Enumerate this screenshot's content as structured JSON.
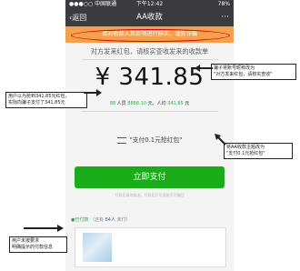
{
  "status_bar": {
    "carrier": "●●●○○ 中国联通",
    "time": "下午12:42",
    "battery": "78%"
  },
  "nav": {
    "back_label": "返回",
    "title": "AA收款",
    "more": "···"
  },
  "warning": "请对收款人及款项进行核实，谨防诈骗",
  "description": "对方发来红包，请核实查收发来的收款单",
  "amount": "¥ 341.85",
  "breakdown": {
    "count": "88",
    "people_label": "人员",
    "total": "8888.10",
    "total_label": "元，人均",
    "per_person": "341.85",
    "unit": "元"
  },
  "reason": "\"支付0.1元抢红包\"",
  "pay_button": "立即支付",
  "notice": "付款后请勿取消，付款后只可退款不可撤回",
  "record": {
    "paid_label": "●已付款",
    "mid": "（还有",
    "count": "84人",
    "end": "未付）"
  },
  "annotations": {
    "right_top": "骗子将账号昵称改为\n\"对方发来红包，请核实查收\"",
    "left": "用户以为抢到341.85元红包，\n实际向骗子支付了341.85元",
    "right_mid": "将AA收款主题改为\n\"支付0.1元抢红包\"",
    "left_bottom": "用户未按要求\n明确提示的付款信息"
  },
  "colors": {
    "nav_bg": "#3b3b3f",
    "warning_bg": "#f5a04b",
    "warning_circle": "#d0021b",
    "pay_button": "#1aad19",
    "accent_green": "#31a84f"
  }
}
